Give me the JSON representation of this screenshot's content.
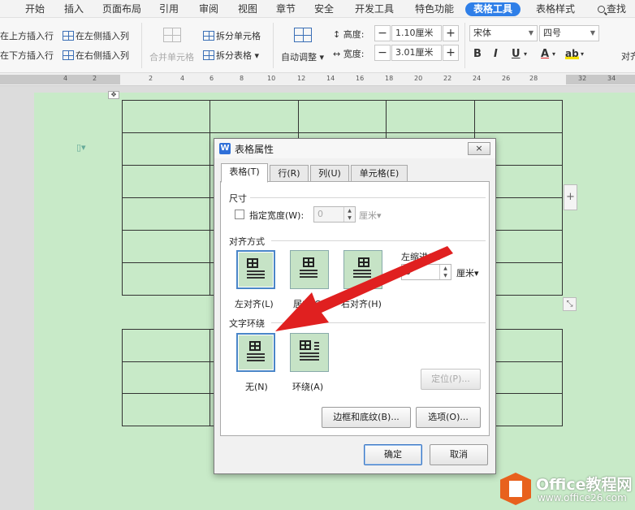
{
  "menubar": {
    "items": [
      "开始",
      "插入",
      "页面布局",
      "引用",
      "审阅",
      "视图",
      "章节",
      "安全",
      "开发工具",
      "特色功能",
      "表格工具",
      "表格样式"
    ],
    "active": "表格工具",
    "search": "查找"
  },
  "ribbon": {
    "insert_above": "在上方插入行",
    "insert_left": "在左侧插入列",
    "insert_below": "在下方插入行",
    "insert_right": "在右侧插入列",
    "merge_cells": "合并单元格",
    "split_cells": "拆分单元格",
    "split_table": "拆分表格",
    "auto_adjust": "自动调整",
    "height_label": "高度:",
    "height_value": "1.10厘米",
    "width_label": "宽度:",
    "width_value": "3.01厘米",
    "font_name": "宋体",
    "font_size": "四号",
    "bold": "B",
    "italic": "I",
    "underline": "U",
    "font_color": "A",
    "highlight": "ab",
    "align_partial": "对齐",
    "minus": "−",
    "plus": "+"
  },
  "ruler": {
    "ticks": [
      "4",
      "2",
      "2",
      "4",
      "6",
      "8",
      "10",
      "12",
      "14",
      "16",
      "18",
      "20",
      "22",
      "24",
      "26",
      "28",
      "32",
      "34"
    ]
  },
  "dialog": {
    "title": "表格属性",
    "logo": "W",
    "close": "×",
    "tabs": [
      "表格(T)",
      "行(R)",
      "列(U)",
      "单元格(E)"
    ],
    "size_group": "尺寸",
    "specify_width": "指定宽度(W):",
    "width_value": "0",
    "width_unit": "厘米",
    "align_group": "对齐方式",
    "align_left": "左对齐(L)",
    "align_center": "居中(C)",
    "align_right": "右对齐(H)",
    "indent_label": "左缩进(I):",
    "indent_value": "0",
    "indent_unit": "厘米",
    "wrap_group": "文字环绕",
    "wrap_none": "无(N)",
    "wrap_around": "环绕(A)",
    "position_button": "定位(P)...",
    "borders_button": "边框和底纹(B)...",
    "options_button": "选项(O)...",
    "ok_button": "确定",
    "cancel_button": "取消"
  },
  "watermark": {
    "brand": "Office教程网",
    "url": "www.office26.com"
  },
  "colors": {
    "accent": "#2f7fe8",
    "page_bg": "#c8eac8",
    "arrow": "#e02020",
    "watermark_logo": "#e8611d"
  }
}
